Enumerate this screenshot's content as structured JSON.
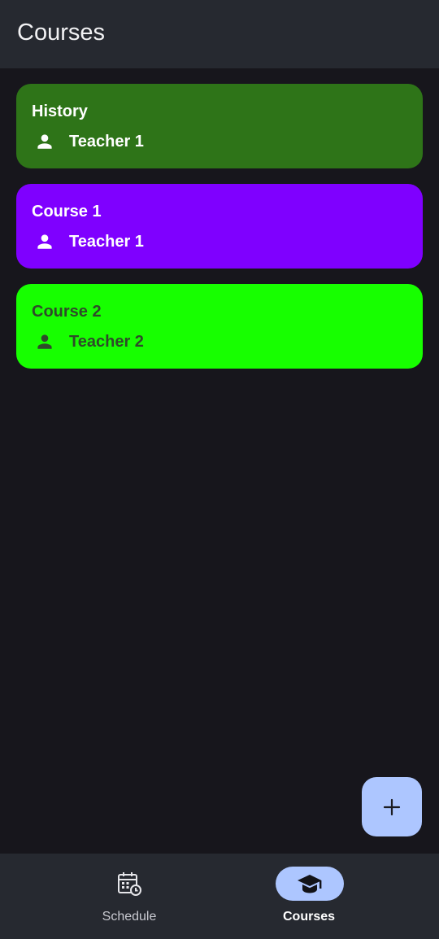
{
  "app_bar": {
    "title": "Courses"
  },
  "courses": [
    {
      "name": "History",
      "teacher": "Teacher 1",
      "color": "#2e7418",
      "text_color": "#ffffff",
      "icon": "person-icon"
    },
    {
      "name": "Course 1",
      "teacher": "Teacher 1",
      "color": "#7f00ff",
      "text_color": "#ffffff",
      "icon": "person-icon"
    },
    {
      "name": "Course 2",
      "teacher": "Teacher 2",
      "color": "#17ff00",
      "text_color": "#2f4a2a",
      "icon": "person-icon"
    }
  ],
  "fab": {
    "icon": "plus-icon"
  },
  "bottom_nav": {
    "items": [
      {
        "label": "Schedule",
        "icon": "calendar-clock-icon",
        "selected": false
      },
      {
        "label": "Courses",
        "icon": "graduation-cap-icon",
        "selected": true
      }
    ],
    "selected_color": "#adc6ff"
  }
}
